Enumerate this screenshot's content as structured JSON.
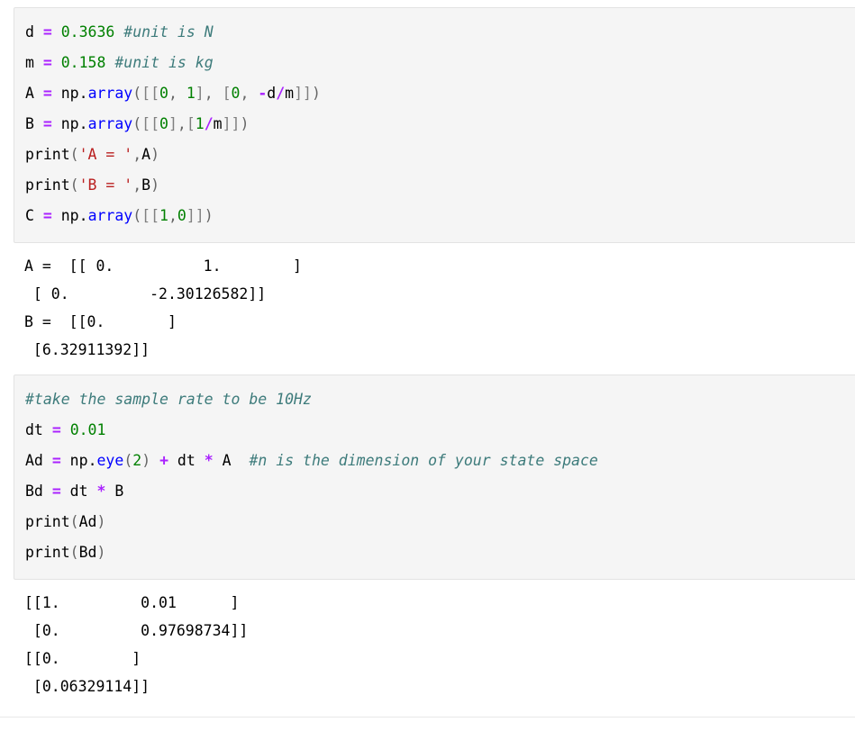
{
  "notebook": {
    "cells": [
      {
        "kind": "code-input",
        "name": "code-cell-1",
        "lines": [
          [
            {
              "t": "d ",
              "c": "tok-name"
            },
            {
              "t": "=",
              "c": "tok-op"
            },
            {
              "t": " ",
              "c": "tok-name"
            },
            {
              "t": "0.3636",
              "c": "tok-num"
            },
            {
              "t": " ",
              "c": "tok-name"
            },
            {
              "t": "#unit is N",
              "c": "tok-comment"
            }
          ],
          [
            {
              "t": "m ",
              "c": "tok-name"
            },
            {
              "t": "=",
              "c": "tok-op"
            },
            {
              "t": " ",
              "c": "tok-name"
            },
            {
              "t": "0.158",
              "c": "tok-num"
            },
            {
              "t": " ",
              "c": "tok-name"
            },
            {
              "t": "#unit is kg",
              "c": "tok-comment"
            }
          ],
          [
            {
              "t": "A ",
              "c": "tok-name"
            },
            {
              "t": "=",
              "c": "tok-op"
            },
            {
              "t": " np",
              "c": "tok-name"
            },
            {
              "t": ".",
              "c": "tok-name"
            },
            {
              "t": "array",
              "c": "tok-func"
            },
            {
              "t": "(",
              "c": "tok-punct"
            },
            {
              "t": "[[",
              "c": "tok-bracket"
            },
            {
              "t": "0",
              "c": "tok-num"
            },
            {
              "t": ", ",
              "c": "tok-punct"
            },
            {
              "t": "1",
              "c": "tok-num"
            },
            {
              "t": "]",
              "c": "tok-bracket"
            },
            {
              "t": ", ",
              "c": "tok-punct"
            },
            {
              "t": "[",
              "c": "tok-bracket"
            },
            {
              "t": "0",
              "c": "tok-num"
            },
            {
              "t": ", ",
              "c": "tok-punct"
            },
            {
              "t": "-",
              "c": "tok-op"
            },
            {
              "t": "d",
              "c": "tok-name"
            },
            {
              "t": "/",
              "c": "tok-op"
            },
            {
              "t": "m",
              "c": "tok-name"
            },
            {
              "t": "]]",
              "c": "tok-bracket"
            },
            {
              "t": ")",
              "c": "tok-punct"
            }
          ],
          [
            {
              "t": "B ",
              "c": "tok-name"
            },
            {
              "t": "=",
              "c": "tok-op"
            },
            {
              "t": " np",
              "c": "tok-name"
            },
            {
              "t": ".",
              "c": "tok-name"
            },
            {
              "t": "array",
              "c": "tok-func"
            },
            {
              "t": "(",
              "c": "tok-punct"
            },
            {
              "t": "[[",
              "c": "tok-bracket"
            },
            {
              "t": "0",
              "c": "tok-num"
            },
            {
              "t": "]",
              "c": "tok-bracket"
            },
            {
              "t": ",",
              "c": "tok-punct"
            },
            {
              "t": "[",
              "c": "tok-bracket"
            },
            {
              "t": "1",
              "c": "tok-num"
            },
            {
              "t": "/",
              "c": "tok-op"
            },
            {
              "t": "m",
              "c": "tok-name"
            },
            {
              "t": "]]",
              "c": "tok-bracket"
            },
            {
              "t": ")",
              "c": "tok-punct"
            }
          ],
          [
            {
              "t": "print",
              "c": "tok-name"
            },
            {
              "t": "(",
              "c": "tok-punct"
            },
            {
              "t": "'A = '",
              "c": "tok-str"
            },
            {
              "t": ",",
              "c": "tok-punct"
            },
            {
              "t": "A",
              "c": "tok-name"
            },
            {
              "t": ")",
              "c": "tok-punct"
            }
          ],
          [
            {
              "t": "print",
              "c": "tok-name"
            },
            {
              "t": "(",
              "c": "tok-punct"
            },
            {
              "t": "'B = '",
              "c": "tok-str"
            },
            {
              "t": ",",
              "c": "tok-punct"
            },
            {
              "t": "B",
              "c": "tok-name"
            },
            {
              "t": ")",
              "c": "tok-punct"
            }
          ],
          [
            {
              "t": "C ",
              "c": "tok-name"
            },
            {
              "t": "=",
              "c": "tok-op"
            },
            {
              "t": " np",
              "c": "tok-name"
            },
            {
              "t": ".",
              "c": "tok-name"
            },
            {
              "t": "array",
              "c": "tok-func"
            },
            {
              "t": "(",
              "c": "tok-punct"
            },
            {
              "t": "[[",
              "c": "tok-bracket"
            },
            {
              "t": "1",
              "c": "tok-num"
            },
            {
              "t": ",",
              "c": "tok-punct"
            },
            {
              "t": "0",
              "c": "tok-num"
            },
            {
              "t": "]]",
              "c": "tok-bracket"
            },
            {
              "t": ")",
              "c": "tok-punct"
            }
          ]
        ]
      },
      {
        "kind": "code-output",
        "name": "output-cell-1",
        "text": "A =  [[ 0.          1.        ]\n [ 0.         -2.30126582]]\nB =  [[0.       ]\n [6.32911392]]"
      },
      {
        "kind": "code-input",
        "name": "code-cell-2",
        "lines": [
          [
            {
              "t": "#take the sample rate to be 10Hz",
              "c": "tok-comment"
            }
          ],
          [
            {
              "t": "dt ",
              "c": "tok-name"
            },
            {
              "t": "=",
              "c": "tok-op"
            },
            {
              "t": " ",
              "c": "tok-name"
            },
            {
              "t": "0.01",
              "c": "tok-num"
            }
          ],
          [
            {
              "t": "Ad ",
              "c": "tok-name"
            },
            {
              "t": "=",
              "c": "tok-op"
            },
            {
              "t": " np",
              "c": "tok-name"
            },
            {
              "t": ".",
              "c": "tok-name"
            },
            {
              "t": "eye",
              "c": "tok-func"
            },
            {
              "t": "(",
              "c": "tok-punct"
            },
            {
              "t": "2",
              "c": "tok-num"
            },
            {
              "t": ") ",
              "c": "tok-punct"
            },
            {
              "t": "+",
              "c": "tok-op"
            },
            {
              "t": " dt ",
              "c": "tok-name"
            },
            {
              "t": "*",
              "c": "tok-op"
            },
            {
              "t": " A",
              "c": "tok-name"
            },
            {
              "t": "  ",
              "c": "tok-name"
            },
            {
              "t": "#n is the dimension of your state space",
              "c": "tok-comment"
            }
          ],
          [
            {
              "t": "Bd ",
              "c": "tok-name"
            },
            {
              "t": "=",
              "c": "tok-op"
            },
            {
              "t": " dt ",
              "c": "tok-name"
            },
            {
              "t": "*",
              "c": "tok-op"
            },
            {
              "t": " B",
              "c": "tok-name"
            }
          ],
          [
            {
              "t": "print",
              "c": "tok-name"
            },
            {
              "t": "(",
              "c": "tok-punct"
            },
            {
              "t": "Ad",
              "c": "tok-name"
            },
            {
              "t": ")",
              "c": "tok-punct"
            }
          ],
          [
            {
              "t": "print",
              "c": "tok-name"
            },
            {
              "t": "(",
              "c": "tok-punct"
            },
            {
              "t": "Bd",
              "c": "tok-name"
            },
            {
              "t": ")",
              "c": "tok-punct"
            }
          ]
        ]
      },
      {
        "kind": "code-output",
        "name": "output-cell-2",
        "text": "[[1.         0.01      ]\n [0.         0.97698734]]\n[[0.        ]\n [0.06329114]]"
      },
      {
        "kind": "divider",
        "name": "cell-divider"
      }
    ]
  },
  "colors": {
    "cell_background": "#f5f5f5",
    "cell_border": "#e3e3e3",
    "page_background": "#ffffff",
    "operator": "#aa22ff",
    "number": "#008000",
    "string": "#ba2121",
    "comment": "#3d7b7b",
    "function": "#0000ff",
    "text": "#000000"
  }
}
